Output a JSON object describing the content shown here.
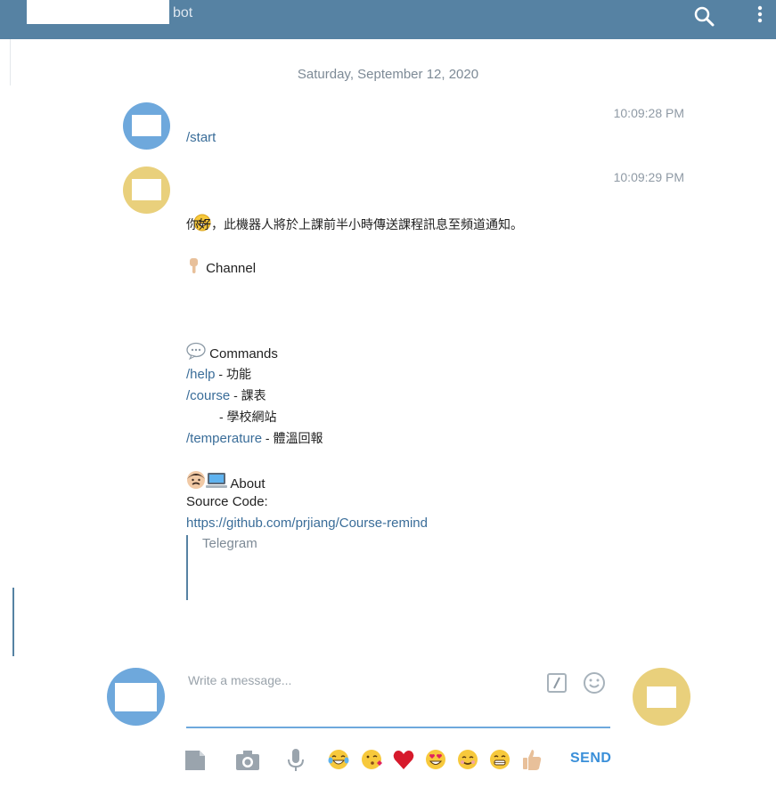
{
  "header": {
    "title_suffix": "bot"
  },
  "date_separator": "Saturday, September 12, 2020",
  "messages": [
    {
      "time": "10:09:28 PM",
      "text": "/start"
    },
    {
      "time": "10:09:29 PM",
      "greeting": "你好，此機器人將於上課前半小時傳送課程訊息至頻道通知。",
      "channel_label": "Channel",
      "commands_label": "Commands",
      "cmd_help": "/help",
      "cmd_help_desc": " - 功能",
      "cmd_course": "/course",
      "cmd_course_desc": " - 課表",
      "school_site": "- 學校網站",
      "cmd_temp": "/temperature",
      "cmd_temp_desc": " - 體溫回報",
      "about_label": "About",
      "source_label": "Source Code:",
      "source_link": "https://github.com/prjiang/Course-remind",
      "preview_site": "Telegram"
    }
  ],
  "composer": {
    "placeholder": "Write a message..."
  },
  "send_label": "SEND",
  "icons": [
    "search-icon",
    "more-icon",
    "grinning-face-emoji",
    "pointing-down-emoji",
    "speech-bubble-emoji",
    "man-emoji",
    "computer-emoji",
    "command-icon",
    "smiley-icon",
    "file-icon",
    "camera-icon",
    "mic-icon",
    "tears-of-joy-emoji",
    "kissing-emoji",
    "heart-emoji",
    "heart-eyes-emoji",
    "smiling-emoji",
    "grin-emoji",
    "thumbs-up-emoji"
  ],
  "colors": {
    "header": "#5682a3",
    "link": "#3a6d99",
    "send": "#3a8fd9",
    "avatar_user": "#6ea8dc",
    "avatar_bot": "#e9d07c"
  }
}
